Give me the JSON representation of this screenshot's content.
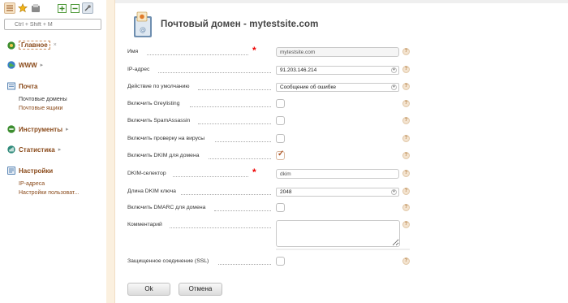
{
  "sidebar": {
    "search_placeholder": "Ctrl + Shift + M",
    "sections": [
      {
        "label": "Главное",
        "items": []
      },
      {
        "label": "WWW",
        "items": []
      },
      {
        "label": "Почта",
        "items": [
          "Почтовые домены",
          "Почтовые ящики"
        ]
      },
      {
        "label": "Инструменты",
        "items": []
      },
      {
        "label": "Статистика",
        "items": []
      },
      {
        "label": "Настройки",
        "items": [
          "IP-адреса",
          "Настройки пользоват..."
        ]
      }
    ]
  },
  "page": {
    "title": "Почтовый домен - mytestsite.com"
  },
  "form": {
    "name": {
      "label": "Имя",
      "value": "mytestsite.com"
    },
    "ip": {
      "label": "IP-адрес",
      "value": "91.203.146.214"
    },
    "default_action": {
      "label": "Действие по умолчанию",
      "value": "Сообщение об ошибке"
    },
    "greylisting": {
      "label": "Включить Greylisting",
      "checked": false
    },
    "spamassassin": {
      "label": "Включить SpamAssassin",
      "checked": false
    },
    "virus": {
      "label": "Включить проверку на вирусы",
      "checked": false
    },
    "dkim": {
      "label": "Включить DKIM для домена",
      "checked": true
    },
    "dkim_selector": {
      "label": "DKIM-селектор",
      "value": "dkim"
    },
    "dkim_length": {
      "label": "Длина DKIM ключа",
      "value": "2048"
    },
    "dmarc": {
      "label": "Включить DMARC для домена",
      "checked": false
    },
    "comment": {
      "label": "Комментарий",
      "value": ""
    },
    "ssl": {
      "label": "Защищенное соединение (SSL)",
      "checked": false
    },
    "help_glyph": "?",
    "required_glyph": "*"
  },
  "buttons": {
    "ok": "Ok",
    "cancel": "Отмена"
  },
  "icons": {
    "toolbar": [
      "list-icon",
      "star-icon",
      "save-icon",
      "expand-icon",
      "collapse-icon",
      "pin-icon"
    ],
    "nav": [
      "home-icon",
      "globe-icon",
      "mail-icon",
      "tools-icon",
      "stats-icon",
      "settings-icon"
    ]
  },
  "colors": {
    "accent": "#8a4a1a",
    "required": "#e00000",
    "sidebar_divider": "#fbf0df",
    "help_bg": "#f3e3cf"
  }
}
